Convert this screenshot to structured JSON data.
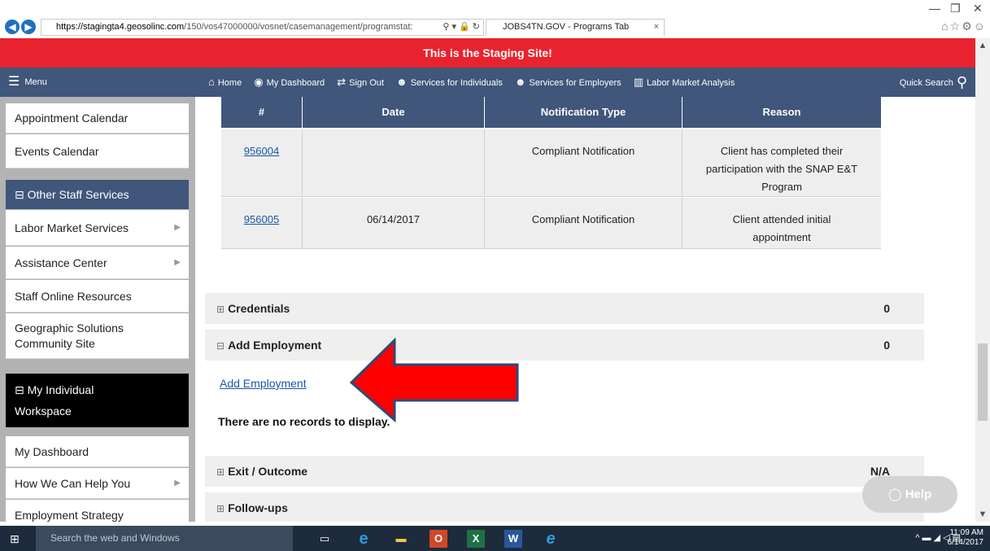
{
  "browser": {
    "url_host": "https://stagingta4.geosolinc.com",
    "url_path": "/150/vos47000000/vosnet/casemanagement/programstat:",
    "tab_title": "JOBS4TN.GOV - Programs Tab"
  },
  "banner": {
    "text": "This is the Staging Site!"
  },
  "topnav": {
    "menu_label": "Menu",
    "links": [
      "Home",
      "My Dashboard",
      "Sign Out",
      "Services for Individuals",
      "Services for Employers",
      "Labor Market Analysis"
    ],
    "quick_search": "Quick Search"
  },
  "sidebar": {
    "items_top": [
      "Appointment Calendar",
      "Events Calendar"
    ],
    "other_staff_header": "Other Staff Services",
    "other_staff_items": [
      "Labor Market Services",
      "Assistance Center",
      "Staff Online Resources",
      "Geographic Solutions",
      "Community Site"
    ],
    "workspace_header_1": "My Individual",
    "workspace_header_2": "Workspace",
    "workspace_items": [
      "My Dashboard",
      "How We Can Help You",
      "Employment Strategy"
    ]
  },
  "notifications": {
    "headers": [
      "#",
      "Date",
      "Notification Type",
      "Reason"
    ],
    "rows": [
      {
        "id": "956004",
        "date": "",
        "type": "Compliant Notification",
        "reason_1": "Client has completed their",
        "reason_2": "participation with the SNAP E&T",
        "reason_3": "Program"
      },
      {
        "id": "956005",
        "date": "06/14/2017",
        "type": "Compliant Notification",
        "reason_1": "Client attended initial",
        "reason_2": "appointment",
        "reason_3": ""
      }
    ]
  },
  "sections": {
    "credentials": {
      "label": "Credentials",
      "count": "0"
    },
    "add_employment": {
      "label": "Add Employment",
      "count": "0",
      "link": "Add Employment",
      "empty": "There are no records to display."
    },
    "exit_outcome": {
      "label": "Exit / Outcome",
      "count": "N/A"
    },
    "follow_ups": {
      "label": "Follow-ups",
      "count": ""
    }
  },
  "help": {
    "label": "Help"
  },
  "taskbar": {
    "search_placeholder": "Search the web and Windows",
    "time": "11:09 AM",
    "date": "6/14/2017"
  },
  "colors": {
    "banner": "#e8232f",
    "nav": "#40567a",
    "arrow": "#ff0000"
  }
}
